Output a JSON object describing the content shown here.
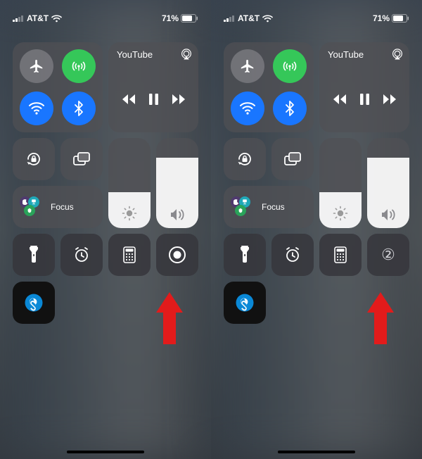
{
  "status": {
    "carrier": "AT&T",
    "battery_pct": "71%"
  },
  "media": {
    "title": "YouTube"
  },
  "focus": {
    "label": "Focus"
  },
  "record_variant_b": "②",
  "sliders": {
    "brightness_fill_pct": 40,
    "volume_fill_pct": 78
  },
  "colors": {
    "green": "#35c759",
    "blue": "#1976ff",
    "arrow": "#E21B1B"
  }
}
